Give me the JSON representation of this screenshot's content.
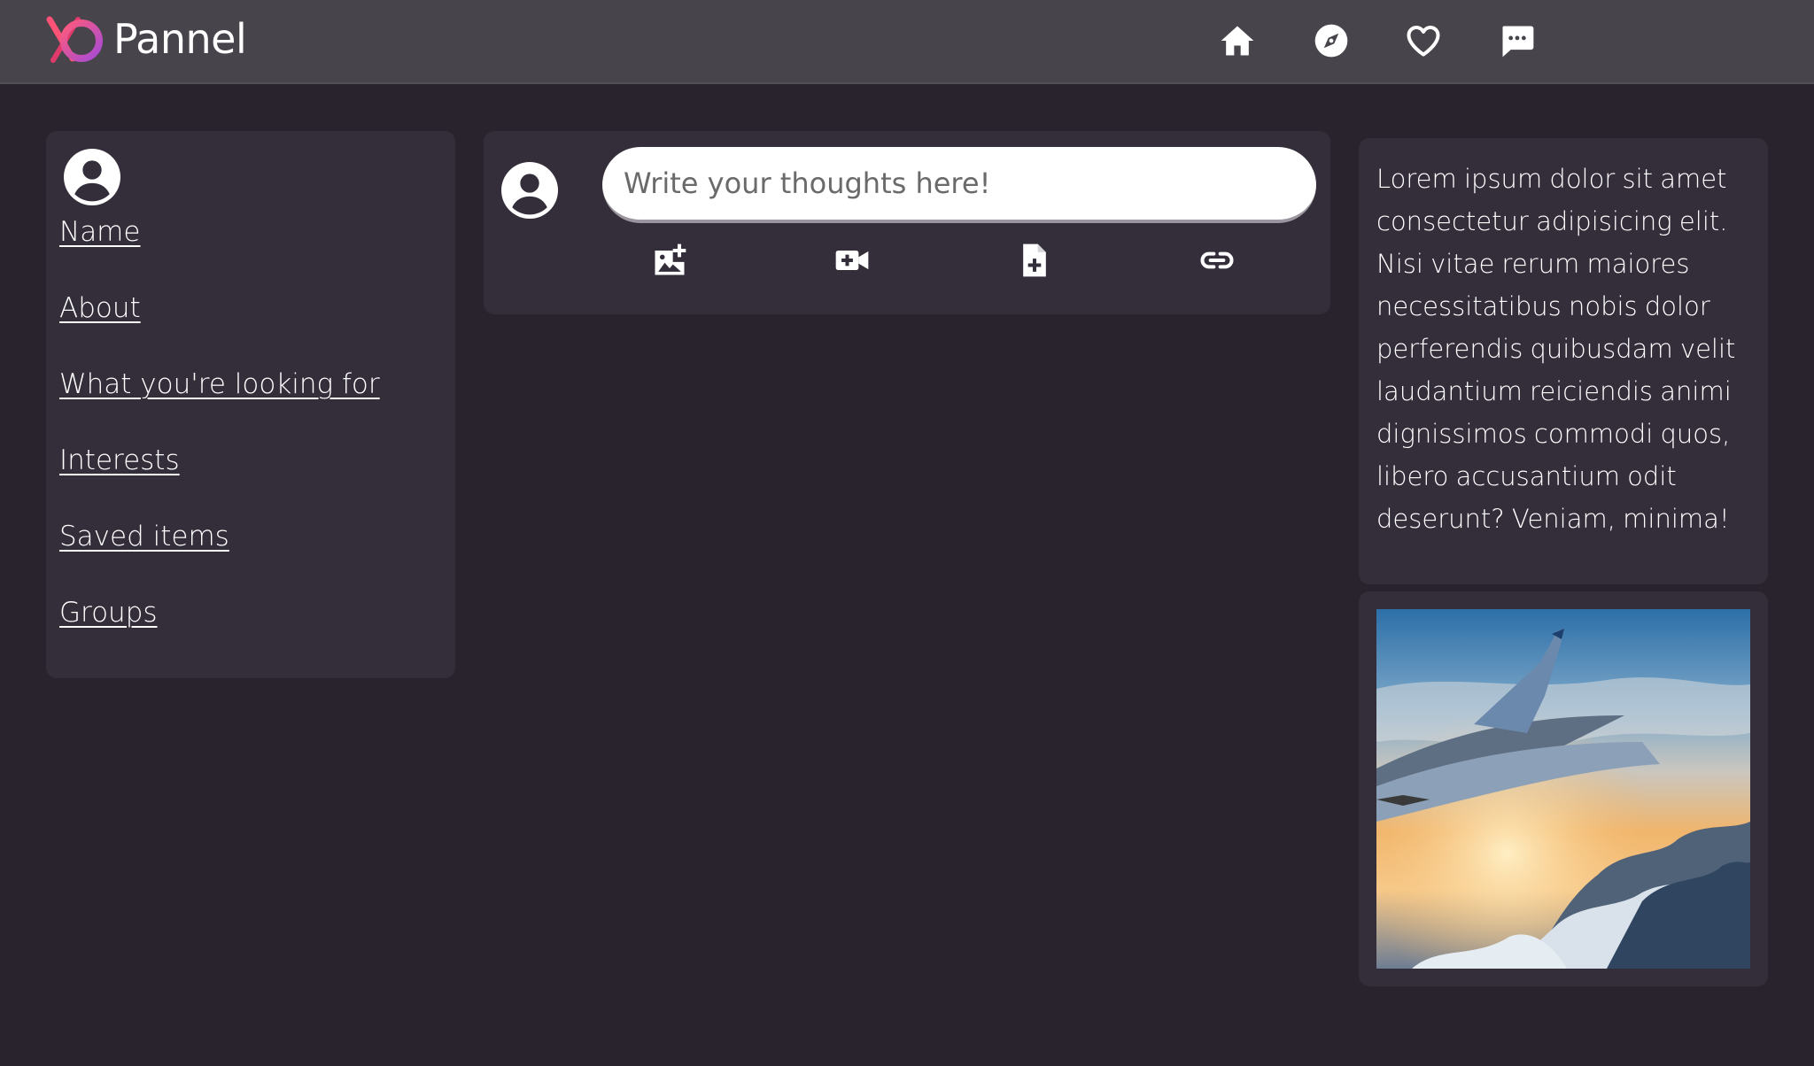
{
  "header": {
    "brand_name": "Pannel",
    "nav_icons": [
      "home-icon",
      "compass-icon",
      "heart-icon",
      "chat-icon"
    ]
  },
  "sidebar": {
    "links": [
      {
        "label": "Name"
      },
      {
        "label": "About"
      },
      {
        "label": "What you're looking for"
      },
      {
        "label": "Interests"
      },
      {
        "label": "Saved items"
      },
      {
        "label": "Groups"
      }
    ]
  },
  "composer": {
    "placeholder": "Write your thoughts here!",
    "tools": [
      "add-photo-icon",
      "video-add-icon",
      "add-file-icon",
      "link-icon"
    ]
  },
  "aside": {
    "text": "Lorem ipsum dolor sit amet consectetur adipisicing elit. Nisi vitae rerum maiores necessitatibus nobis dolor perferendis quibusdam velit laudantium reiciendis animi dignissimos commodi quos, libero accusantium odit deserunt? Veniam, minima!"
  },
  "colors": {
    "background": "#29232d",
    "topbar": "#48444c",
    "panel": "#342d3a",
    "logo_pink": "#e8457a",
    "logo_purple": "#b14fcf"
  }
}
